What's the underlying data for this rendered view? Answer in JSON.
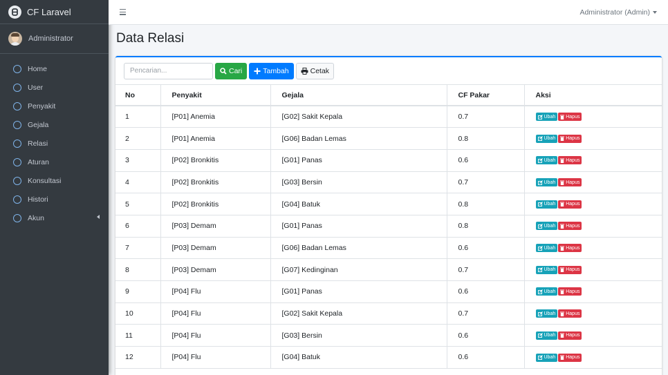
{
  "brand": {
    "name": "CF Laravel"
  },
  "user": {
    "name": "Administrator"
  },
  "topbar": {
    "user_menu": "Administrator (Admin)"
  },
  "sidebar": {
    "items": [
      {
        "label": "Home"
      },
      {
        "label": "User"
      },
      {
        "label": "Penyakit"
      },
      {
        "label": "Gejala"
      },
      {
        "label": "Relasi"
      },
      {
        "label": "Aturan"
      },
      {
        "label": "Konsultasi"
      },
      {
        "label": "Histori"
      },
      {
        "label": "Akun"
      }
    ]
  },
  "page": {
    "title": "Data Relasi"
  },
  "toolbar": {
    "search_placeholder": "Pencarian...",
    "cari_label": "Cari",
    "tambah_label": "Tambah",
    "cetak_label": "Cetak"
  },
  "table": {
    "headers": [
      "No",
      "Penyakit",
      "Gejala",
      "CF Pakar",
      "Aksi"
    ],
    "action_edit": "Ubah",
    "action_delete": "Hapus",
    "rows": [
      {
        "no": "1",
        "penyakit": "[P01] Anemia",
        "gejala": "[G02] Sakit Kepala",
        "cf": "0.7"
      },
      {
        "no": "2",
        "penyakit": "[P01] Anemia",
        "gejala": "[G06] Badan Lemas",
        "cf": "0.8"
      },
      {
        "no": "3",
        "penyakit": "[P02] Bronkitis",
        "gejala": "[G01] Panas",
        "cf": "0.6"
      },
      {
        "no": "4",
        "penyakit": "[P02] Bronkitis",
        "gejala": "[G03] Bersin",
        "cf": "0.7"
      },
      {
        "no": "5",
        "penyakit": "[P02] Bronkitis",
        "gejala": "[G04] Batuk",
        "cf": "0.8"
      },
      {
        "no": "6",
        "penyakit": "[P03] Demam",
        "gejala": "[G01] Panas",
        "cf": "0.8"
      },
      {
        "no": "7",
        "penyakit": "[P03] Demam",
        "gejala": "[G06] Badan Lemas",
        "cf": "0.6"
      },
      {
        "no": "8",
        "penyakit": "[P03] Demam",
        "gejala": "[G07] Kedinginan",
        "cf": "0.7"
      },
      {
        "no": "9",
        "penyakit": "[P04] Flu",
        "gejala": "[G01] Panas",
        "cf": "0.6"
      },
      {
        "no": "10",
        "penyakit": "[P04] Flu",
        "gejala": "[G02] Sakit Kepala",
        "cf": "0.7"
      },
      {
        "no": "11",
        "penyakit": "[P04] Flu",
        "gejala": "[G03] Bersin",
        "cf": "0.6"
      },
      {
        "no": "12",
        "penyakit": "[P04] Flu",
        "gejala": "[G04] Batuk",
        "cf": "0.6"
      }
    ]
  },
  "colors": {
    "sidebar_bg": "#343a40",
    "primary": "#007bff",
    "success": "#28a745",
    "info": "#17a2b8",
    "danger": "#dc3545"
  }
}
